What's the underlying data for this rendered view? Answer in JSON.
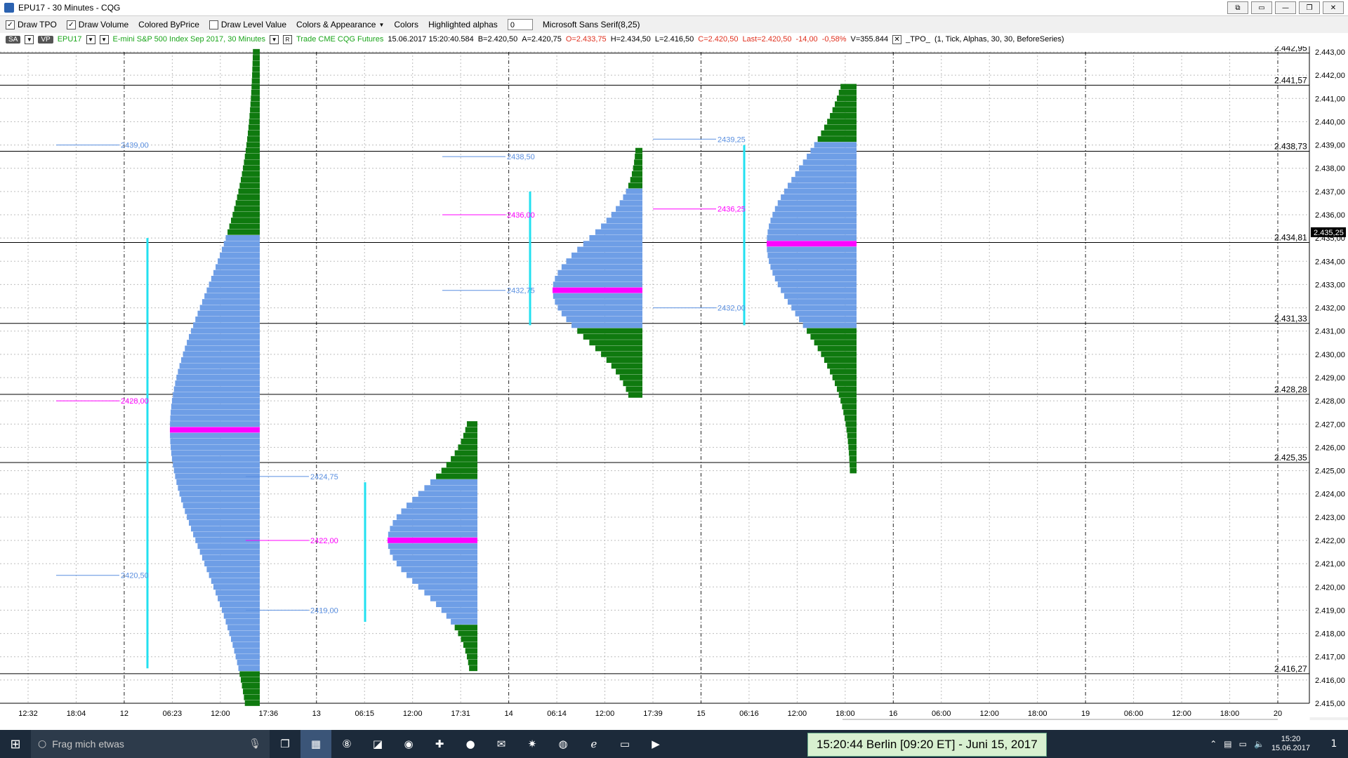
{
  "window": {
    "title": "EPU17 - 30 Minutes - CQG",
    "buttons": [
      "⧉",
      "▭",
      "—",
      "❐",
      "✕"
    ]
  },
  "toolbar": {
    "draw_tpo": "Draw TPO",
    "draw_volume": "Draw Volume",
    "colored_byprice": "Colored ByPrice",
    "draw_level_value": "Draw Level Value",
    "colors_appearance": "Colors & Appearance",
    "colors": "Colors",
    "highlighted_alphas": "Highlighted alphas",
    "alphas_value": "0",
    "font": "Microsoft Sans Serif(8,25)"
  },
  "infobar": {
    "sa": "SA",
    "vp": "VP",
    "symbol": "EPU17",
    "description": "E-mini S&P 500 Index Sep 2017, 30 Minutes",
    "feed": "Trade CME CQG Futures",
    "datetime": "15.06.2017 15:20:40.584",
    "bid": "B=2.420,50",
    "ask": "A=2.420,75",
    "open": "O=2.433,75",
    "high": "H=2.434,50",
    "low": "L=2.416,50",
    "close": "C=2.420,50",
    "last": "Last=2.420,50",
    "change": "-14,00",
    "change_pct": "-0,58%",
    "volume": "V=355.844",
    "study": "_TPO_",
    "study_params": "(1, Tick, Alphas, 30, 30, BeforeSeries)"
  },
  "colors": {
    "volume_hi": "#0f7a0f",
    "volume_va": "#6e9ee6",
    "poc": "#ff00ff",
    "va_bar": "#22e0f0",
    "tpo_text": "#1f6e1f",
    "tpo_blue": "#5a8fe0",
    "level_line": "#000000"
  },
  "chart_data": {
    "type": "table",
    "title": "",
    "price_axis": {
      "min": 2415.0,
      "max": 2443.0,
      "ticks": [
        "2.443,00",
        "2.442,00",
        "2.441,00",
        "2.440,00",
        "2.439,00",
        "2.438,00",
        "2.437,00",
        "2.436,00",
        "2.435,00",
        "2.434,00",
        "2.433,00",
        "2.432,00",
        "2.431,00",
        "2.430,00",
        "2.429,00",
        "2.428,00",
        "2.427,00",
        "2.426,00",
        "2.425,00",
        "2.424,00",
        "2.423,00",
        "2.422,00",
        "2.421,00",
        "2.420,00",
        "2.419,00",
        "2.418,00",
        "2.417,00",
        "2.416,00",
        "2.415,00"
      ],
      "current_price": "2.435,25"
    },
    "time_axis": [
      "12:32",
      "18:04",
      "12",
      "06:23",
      "12:00",
      "17:36",
      "13",
      "06:15",
      "12:00",
      "17:31",
      "14",
      "06:14",
      "12:00",
      "17:39",
      "15",
      "06:16",
      "12:00",
      "18:00",
      "16",
      "06:00",
      "12:00",
      "18:00",
      "19",
      "06:00",
      "12:00",
      "18:00",
      "20"
    ],
    "levels": [
      {
        "label": "2.442,95",
        "price": 2442.95
      },
      {
        "label": "2.441,57",
        "price": 2441.57
      },
      {
        "label": "2.438,73",
        "price": 2438.73
      },
      {
        "label": "2.434,81",
        "price": 2434.81
      },
      {
        "label": "2.431,33",
        "price": 2431.33
      },
      {
        "label": "2.428,28",
        "price": 2428.28
      },
      {
        "label": "2.425,35",
        "price": 2425.35
      },
      {
        "label": "2.416,27",
        "price": 2416.27
      }
    ],
    "annotations": [
      {
        "label": "2439,00",
        "price": 2439.0,
        "color": "blue"
      },
      {
        "label": "2428,00",
        "price": 2428.0,
        "color": "magenta"
      },
      {
        "label": "2420,50",
        "price": 2420.5,
        "color": "blue"
      },
      {
        "label": "2424,75",
        "price": 2424.75,
        "color": "blue"
      },
      {
        "label": "2422,00",
        "price": 2422.0,
        "color": "magenta"
      },
      {
        "label": "2419,00",
        "price": 2419.0,
        "color": "blue"
      },
      {
        "label": "2438,50",
        "price": 2438.5,
        "color": "blue"
      },
      {
        "label": "2436,00",
        "price": 2436.0,
        "color": "magenta"
      },
      {
        "label": "2432,75",
        "price": 2432.75,
        "color": "blue"
      },
      {
        "label": "2439,25",
        "price": 2439.25,
        "color": "blue"
      },
      {
        "label": "2436,25",
        "price": 2436.25,
        "color": "magenta"
      },
      {
        "label": "2432,00",
        "price": 2432.0,
        "color": "blue"
      }
    ],
    "profiles": [
      {
        "name": "",
        "low": 2415.0,
        "high": 2443.0,
        "poc": 2426.75,
        "va_low": 2416.5,
        "va_high": 2435.0,
        "max_width": 120
      },
      {
        "name": "",
        "low": 2416.5,
        "high": 2427.0,
        "poc": 2422.0,
        "va_low": 2418.5,
        "va_high": 2424.5,
        "max_width": 120
      },
      {
        "name": "",
        "low": 2428.25,
        "high": 2438.75,
        "poc": 2432.75,
        "va_low": 2431.25,
        "va_high": 2437.0,
        "max_width": 120
      },
      {
        "name": "",
        "low": 2425.0,
        "high": 2441.5,
        "poc": 2434.75,
        "va_low": 2431.25,
        "va_high": 2439.0,
        "max_width": 120
      }
    ]
  },
  "taskbar": {
    "search_placeholder": "Frag mich etwas",
    "clock_banner": "15:20:44  Berlin [09:20 ET] - Juni 15, 2017",
    "tray_time": "15:20",
    "tray_date": "15.06.2017",
    "notification_count": "1"
  }
}
